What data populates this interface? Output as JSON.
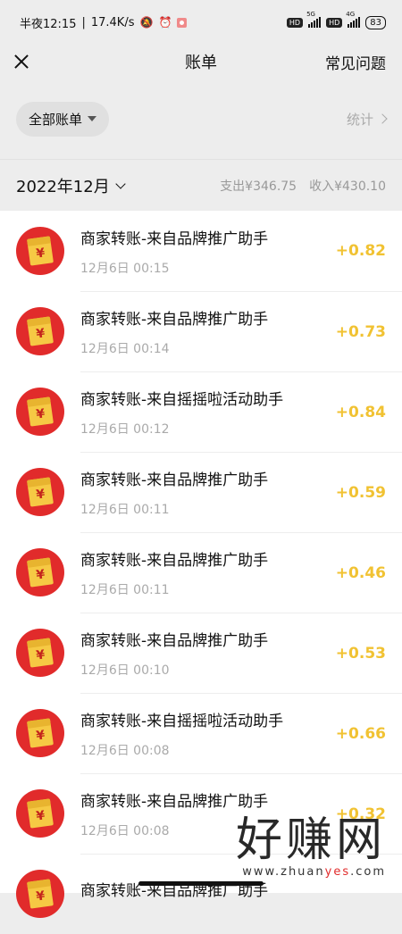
{
  "status_bar": {
    "time": "半夜12:15",
    "speed": "17.4K/s",
    "hd1": "HD",
    "net1": "5G",
    "hd2": "HD",
    "net2": "4G",
    "battery": "83"
  },
  "header": {
    "title": "账单",
    "faq_label": "常见问题"
  },
  "filter": {
    "all_bills_label": "全部账单",
    "stats_label": "统计"
  },
  "month": {
    "label": "2022年12月",
    "expense": "支出¥346.75",
    "income": "收入¥430.10"
  },
  "transactions": [
    {
      "title": "商家转账-来自品牌推广助手",
      "time": "12月6日 00:15",
      "amount": "+0.82"
    },
    {
      "title": "商家转账-来自品牌推广助手",
      "time": "12月6日 00:14",
      "amount": "+0.73"
    },
    {
      "title": "商家转账-来自摇摇啦活动助手",
      "time": "12月6日 00:12",
      "amount": "+0.84"
    },
    {
      "title": "商家转账-来自品牌推广助手",
      "time": "12月6日 00:11",
      "amount": "+0.59"
    },
    {
      "title": "商家转账-来自品牌推广助手",
      "time": "12月6日 00:11",
      "amount": "+0.46"
    },
    {
      "title": "商家转账-来自品牌推广助手",
      "time": "12月6日 00:10",
      "amount": "+0.53"
    },
    {
      "title": "商家转账-来自摇摇啦活动助手",
      "time": "12月6日 00:08",
      "amount": "+0.66"
    },
    {
      "title": "商家转账-来自品牌推广助手",
      "time": "12月6日 00:08",
      "amount": "+0.32"
    },
    {
      "title": "商家转账-来自品牌推广助手",
      "time": "",
      "amount": ""
    }
  ],
  "watermark": {
    "text": "好赚网",
    "url_prefix": "www.zhuan",
    "url_highlight": "yes",
    "url_suffix": ".com"
  },
  "colors": {
    "amount": "#f1c232",
    "avatar_bg": "#e12b2b",
    "page_bg": "#ededed"
  }
}
